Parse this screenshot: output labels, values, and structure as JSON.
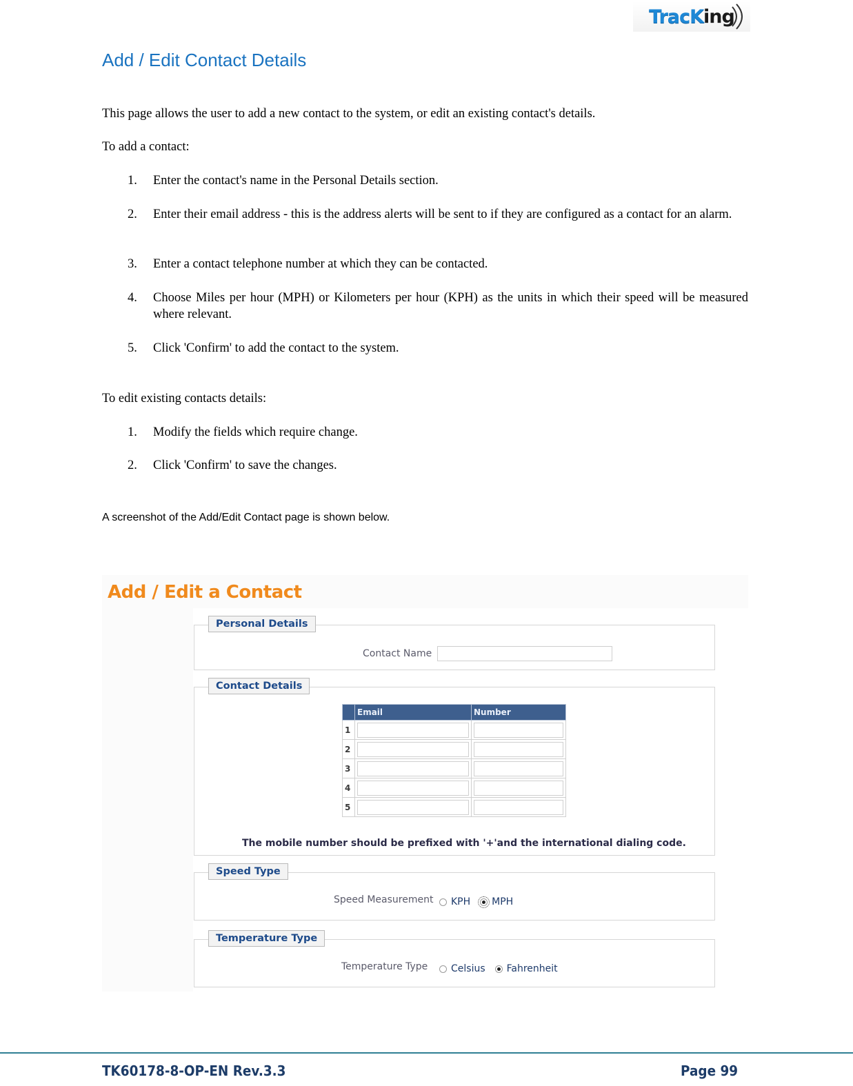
{
  "header": {
    "logo": {
      "text_main": "TracK",
      "text_tail": "ing",
      "icon": "signal-waves-icon"
    }
  },
  "document": {
    "title": "Add / Edit Contact Details",
    "intro": "This page allows the user to add a new contact to the system, or edit an existing contact's details.",
    "add_heading": "To add a contact:",
    "add_steps": [
      {
        "num": "1.",
        "text": "Enter the contact's name in the Personal Details section."
      },
      {
        "num": "2.",
        "text": "Enter their email address - this is the address alerts will be sent to if they are configured as a contact for an alarm."
      },
      {
        "num": "3.",
        "text": "Enter a contact telephone number at which they can be contacted."
      },
      {
        "num": "4.",
        "text": "Choose Miles per hour (MPH) or Kilometers per hour (KPH) as the units in which their speed will be measured where relevant."
      },
      {
        "num": "5.",
        "text": "Click 'Confirm' to add the contact to the system."
      }
    ],
    "edit_heading": "To edit existing contacts details:",
    "edit_steps": [
      {
        "num": "1.",
        "text": "Modify the fields which require change."
      },
      {
        "num": "2.",
        "text": "Click 'Confirm' to save the changes."
      }
    ],
    "caption": "A screenshot of the Add/Edit Contact page is shown below."
  },
  "screenshot": {
    "title": "Add / Edit a Contact",
    "personal": {
      "legend": "Personal Details",
      "contact_name_label": "Contact Name",
      "contact_name_value": ""
    },
    "contact": {
      "legend": "Contact Details",
      "columns": [
        "",
        "Email",
        "Number"
      ],
      "rows": [
        {
          "num": "1",
          "email": "",
          "number": ""
        },
        {
          "num": "2",
          "email": "",
          "number": ""
        },
        {
          "num": "3",
          "email": "",
          "number": ""
        },
        {
          "num": "4",
          "email": "",
          "number": ""
        },
        {
          "num": "5",
          "email": "",
          "number": ""
        }
      ],
      "note": "The mobile number should be prefixed with '+'and the international dialing code."
    },
    "speed": {
      "legend": "Speed Type",
      "label": "Speed Measurement",
      "options": [
        {
          "label": "KPH",
          "checked": false
        },
        {
          "label": "MPH",
          "checked": true
        }
      ]
    },
    "temperature": {
      "legend": "Temperature Type",
      "label": "Temperature Type",
      "options": [
        {
          "label": "Celsius",
          "checked": false
        },
        {
          "label": "Fahrenheit",
          "checked": true
        }
      ]
    }
  },
  "footer": {
    "doc_id": "TK60178-8-OP-EN Rev.3.3",
    "page": "Page  99"
  },
  "colors": {
    "title_blue": "#1a73c0",
    "screenshot_title_orange": "#f08a1d",
    "legend_text": "#1d4a8a",
    "table_header": "#3e5f8e",
    "footer_rule": "#2f7f94",
    "footer_text": "#1d3c68"
  }
}
